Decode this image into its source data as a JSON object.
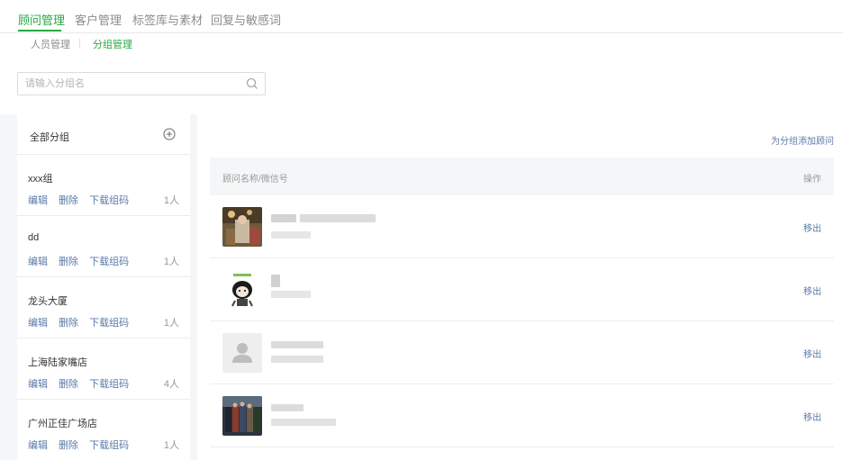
{
  "top_tabs": [
    {
      "label": "顾问管理",
      "active": true
    },
    {
      "label": "客户管理",
      "active": false
    },
    {
      "label": "标签库与素材",
      "active": false
    },
    {
      "label": "回复与敏感词",
      "active": false
    }
  ],
  "sub_tabs": [
    {
      "label": "人员管理",
      "active": false
    },
    {
      "label": "分组管理",
      "active": true
    }
  ],
  "search": {
    "placeholder": "请输入分组名",
    "value": "",
    "icon": "search-icon"
  },
  "left_panel": {
    "header_label": "全部分组",
    "add_icon": "plus-circle-icon",
    "groups": [
      {
        "name": "xxx组",
        "edit": "编辑",
        "delete": "删除",
        "download": "下载组码",
        "count": "1人"
      },
      {
        "name": "dd",
        "edit": "编辑",
        "delete": "删除",
        "download": "下载组码",
        "count": "1人"
      },
      {
        "name": "龙头大厦",
        "edit": "编辑",
        "delete": "删除",
        "download": "下载组码",
        "count": "1人"
      },
      {
        "name": "上海陆家嘴店",
        "edit": "编辑",
        "delete": "删除",
        "download": "下载组码",
        "count": "4人"
      },
      {
        "name": "广州正佳广场店",
        "edit": "编辑",
        "delete": "删除",
        "download": "下载组码",
        "count": "1人"
      }
    ]
  },
  "right_panel": {
    "add_link": "为分组添加顾问",
    "table_headers": {
      "name": "顾问名称/微信号",
      "operation": "操作"
    },
    "rows": [
      {
        "avatar": "photo-avatar-icon",
        "remove": "移出"
      },
      {
        "avatar": "cartoon-avatar-icon",
        "remove": "移出"
      },
      {
        "avatar": "default-user-avatar-icon",
        "remove": "移出"
      },
      {
        "avatar": "poster-avatar-icon",
        "remove": "移出"
      }
    ]
  },
  "colors": {
    "accent": "#27a843",
    "link": "#5a7aa8",
    "muted": "#999999",
    "background": "#f5f6f7"
  }
}
